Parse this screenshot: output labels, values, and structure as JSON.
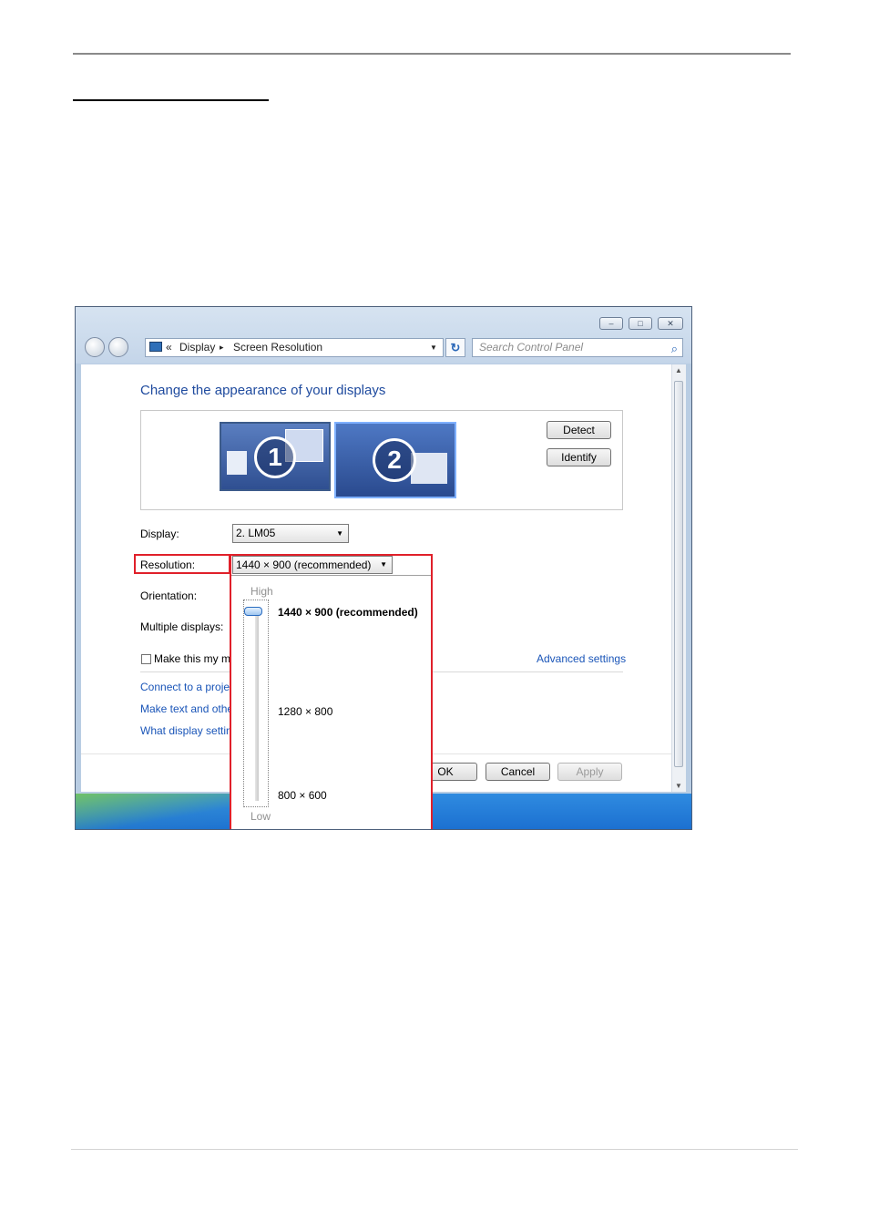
{
  "breadcrumb": {
    "back_chevrons": "«",
    "item1": "Display",
    "separator": "▸",
    "item2": "Screen Resolution"
  },
  "search": {
    "placeholder": "Search Control Panel"
  },
  "window": {
    "caption_buttons": [
      "–",
      "□",
      "✕"
    ]
  },
  "main": {
    "title": "Change the appearance of your displays",
    "monitor1_number": "1",
    "monitor2_number": "2",
    "detect_label": "Detect",
    "identify_label": "Identify",
    "display_label": "Display:",
    "display_value": "2. LM05",
    "resolution_label": "Resolution:",
    "resolution_value": "1440 × 900 (recommended)",
    "orientation_label": "Orientation:",
    "multiple_displays_label": "Multiple displays:",
    "make_main_label": "Make this my m",
    "advanced_settings": "Advanced settings",
    "links": [
      "Connect to a projec",
      "Make text and othe",
      "What display settin"
    ],
    "ok_label": "OK",
    "cancel_label": "Cancel",
    "apply_label": "Apply"
  },
  "resolution_dropdown": {
    "high_label": "High",
    "low_label": "Low",
    "options": [
      "1440 × 900 (recommended)",
      "1280 × 800",
      "800 × 600"
    ],
    "selected_index": 0
  },
  "colors": {
    "highlight_red": "#e0202a",
    "link_blue": "#1a55b8",
    "title_blue": "#1e4a9e"
  }
}
